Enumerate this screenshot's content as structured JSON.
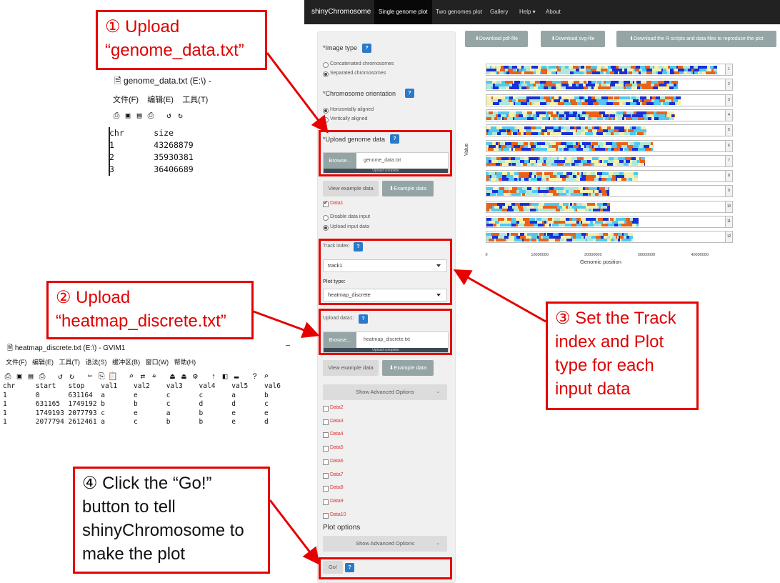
{
  "navbar": {
    "brand": "shinyChromosome",
    "items": [
      "Single genome plot",
      "Two genomes plot",
      "Gallery",
      "Help ▾",
      "About"
    ]
  },
  "download_buttons": [
    "⬇Download pdf-file",
    "⬇Download svg-file",
    "⬇Download the R scripts and data files to reproduce the plot"
  ],
  "sidebar": {
    "image_type": {
      "label": "*Image type",
      "options": [
        "Concatenated chromosomes",
        "Separated chromosomes"
      ],
      "selected": 1
    },
    "orientation": {
      "label": "*Chromosome orientation",
      "options": [
        "Horizontally aligned",
        "Vertically aligned"
      ],
      "selected": 0
    },
    "upload_genome": {
      "label": "*Upload genome data",
      "browse": "Browse...",
      "filename": "genome_data.txt",
      "status": "Upload complete"
    },
    "view_example": "View example data",
    "example_data": "⬇Example data",
    "data1_label": "Data1",
    "input_mode": {
      "options": [
        "Disable data input",
        "Upload input data"
      ],
      "selected": 1
    },
    "track_index": {
      "label": "Track index:",
      "value": "track1"
    },
    "plot_type": {
      "label": "Plot type:",
      "value": "heatmap_discrete"
    },
    "upload_data1": {
      "label": "Upload data1:",
      "browse": "Browse...",
      "filename": "heatmap_discrete.txt",
      "status": "Upload complete"
    },
    "show_advanced": "Show Advanced Options",
    "data_items": [
      "Data2",
      "Data3",
      "Data4",
      "Data5",
      "Data6",
      "Data7",
      "Data8",
      "Data9",
      "Data10"
    ],
    "plot_options": "Plot options",
    "go": "Go!",
    "help": "?"
  },
  "callouts": {
    "c1_num": "①",
    "c1_l1": " Upload",
    "c1_l2": "“genome_data.txt”",
    "c2_num": "②",
    "c2_l1": " Upload",
    "c2_l2": "“heatmap_discrete.txt”",
    "c3_num": "③",
    "c3_l1": " Set the Track",
    "c3_l2": "index and Plot",
    "c3_l3": "type for each",
    "c3_l4": "input data",
    "c4_num": "④",
    "c4_l1": " Click the “Go!”",
    "c4_l2": "button to tell",
    "c4_l3": "shinyChromosome to",
    "c4_l4": "make the plot"
  },
  "gvim1": {
    "title": "genome_data.txt (E:\\) -",
    "menu": [
      "文件(F)",
      "编辑(E)",
      "工具(T)"
    ],
    "lines": [
      "chr      size",
      "1        43268879",
      "2        35930381",
      "3        36406689"
    ]
  },
  "gvim2": {
    "title": "heatmap_discrete.txt (E:\\) - GVIM1",
    "close": "—",
    "menu": [
      "文件(F)",
      "编辑(E)",
      "工具(T)",
      "语法(S)",
      "缓冲区(B)",
      "窗口(W)",
      "帮助(H)"
    ],
    "header": "chr     start   stop    val1    val2    val3    val4    val5    val6",
    "rows": [
      "1       0       631164  a       e       c       c       a       b",
      "1       631165  1749192 b       b       c       d       d       c",
      "1       1749193 2077793 c       e       a       b       e       e",
      "1       2077794 2612461 a       c       b       b       e       d"
    ]
  },
  "plot": {
    "ylabel": "Value",
    "xlabel": "Genomic position",
    "x_ticks": [
      "0",
      "10000000",
      "20000000",
      "30000000",
      "40000000"
    ],
    "x_max": 45000000,
    "track_labels": [
      "1",
      "2",
      "3",
      "4",
      "5",
      "6",
      "7",
      "8",
      "9",
      "10",
      "11",
      "12"
    ],
    "chrom_lengths": [
      43268879,
      35930381,
      36406689,
      35278225,
      29894789,
      31246789,
      29696629,
      28439308,
      23012720,
      23207287,
      28462103,
      27497214
    ],
    "category_colors": [
      "#1a2fd6",
      "#4fc9f0",
      "#f4f0b0",
      "#e8621a",
      "#b0e8d8"
    ]
  }
}
